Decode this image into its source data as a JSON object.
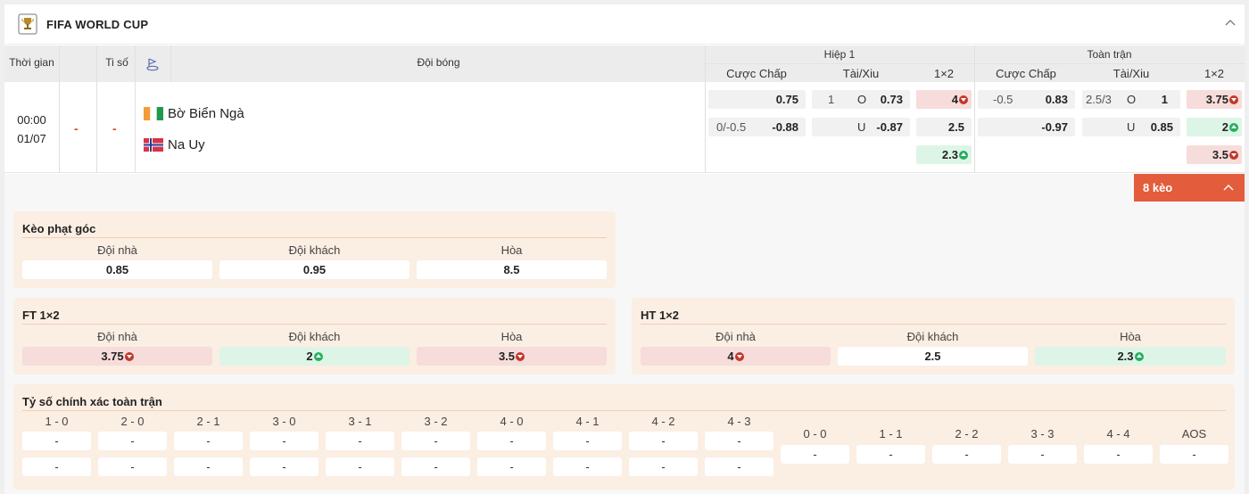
{
  "league": {
    "name": "FIFA WORLD CUP",
    "trophy_icon": "trophy-icon",
    "collapse_icon": "chevron-up-icon"
  },
  "table_header": {
    "time": "Thời gian",
    "score": "Ti số",
    "team": "Đội bóng",
    "half1": "Hiệp 1",
    "fulltime": "Toàn trận",
    "handicap": "Cược Chấp",
    "over_under": "Tài/Xiu",
    "one_x_two": "1×2"
  },
  "match": {
    "time": "00:00",
    "date": "01/07",
    "score_home": "-",
    "score_away": "-",
    "home": {
      "name": "Bờ Biển Ngà",
      "flag": "ivory-coast-flag"
    },
    "away": {
      "name": "Na Uy",
      "flag": "norway-flag"
    },
    "h1": {
      "handicap": [
        {
          "line": "",
          "odds": "0.75"
        },
        {
          "line": "0/-0.5",
          "odds": "-0.88"
        }
      ],
      "over_under": [
        {
          "line": "1",
          "side": "O",
          "odds": "0.73"
        },
        {
          "line": "",
          "side": "U",
          "odds": "-0.87"
        }
      ],
      "x12": [
        {
          "odds": "4",
          "trend": "down"
        },
        {
          "odds": "2.5",
          "trend": ""
        },
        {
          "odds": "2.3",
          "trend": "up"
        }
      ]
    },
    "ft": {
      "handicap": [
        {
          "line": "-0.5",
          "odds": "0.83"
        },
        {
          "line": "",
          "odds": "-0.97"
        }
      ],
      "over_under": [
        {
          "line": "2.5/3",
          "side": "O",
          "odds": "1"
        },
        {
          "line": "",
          "side": "U",
          "odds": "0.85"
        }
      ],
      "x12": [
        {
          "odds": "3.75",
          "trend": "down"
        },
        {
          "odds": "2",
          "trend": "up"
        },
        {
          "odds": "3.5",
          "trend": "down"
        }
      ]
    }
  },
  "more_bets": {
    "label": "8 kèo",
    "icon": "chevron-up-icon"
  },
  "corners": {
    "title": "Kèo phạt góc",
    "cols": [
      "Đội nhà",
      "Đội khách",
      "Hòa"
    ],
    "values": [
      "0.85",
      "0.95",
      "8.5"
    ]
  },
  "ft_1x2": {
    "title": "FT 1×2",
    "cols": [
      "Đội nhà",
      "Đội khách",
      "Hòa"
    ],
    "values": [
      "3.75",
      "2",
      "3.5"
    ]
  },
  "ht_1x2": {
    "title": "HT 1×2",
    "cols": [
      "Đội nhà",
      "Đội khách",
      "Hòa"
    ],
    "values": [
      "4",
      "2.5",
      "2.3"
    ]
  },
  "correct_score": {
    "title": "Tỷ số chính xác toàn trận",
    "home_scores": [
      "1 - 0",
      "2 - 0",
      "2 - 1",
      "3 - 0",
      "3 - 1",
      "3 - 2",
      "4 - 0",
      "4 - 1",
      "4 - 2",
      "4 - 3"
    ],
    "draw_scores": [
      "0 - 0",
      "1 - 1",
      "2 - 2",
      "3 - 3",
      "4 - 4",
      "AOS"
    ],
    "empty_value": "-"
  },
  "colors": {
    "accent": "#e35d3c",
    "down": "#c0392b",
    "up": "#27ae60",
    "panel_bg": "#fbeee3"
  }
}
